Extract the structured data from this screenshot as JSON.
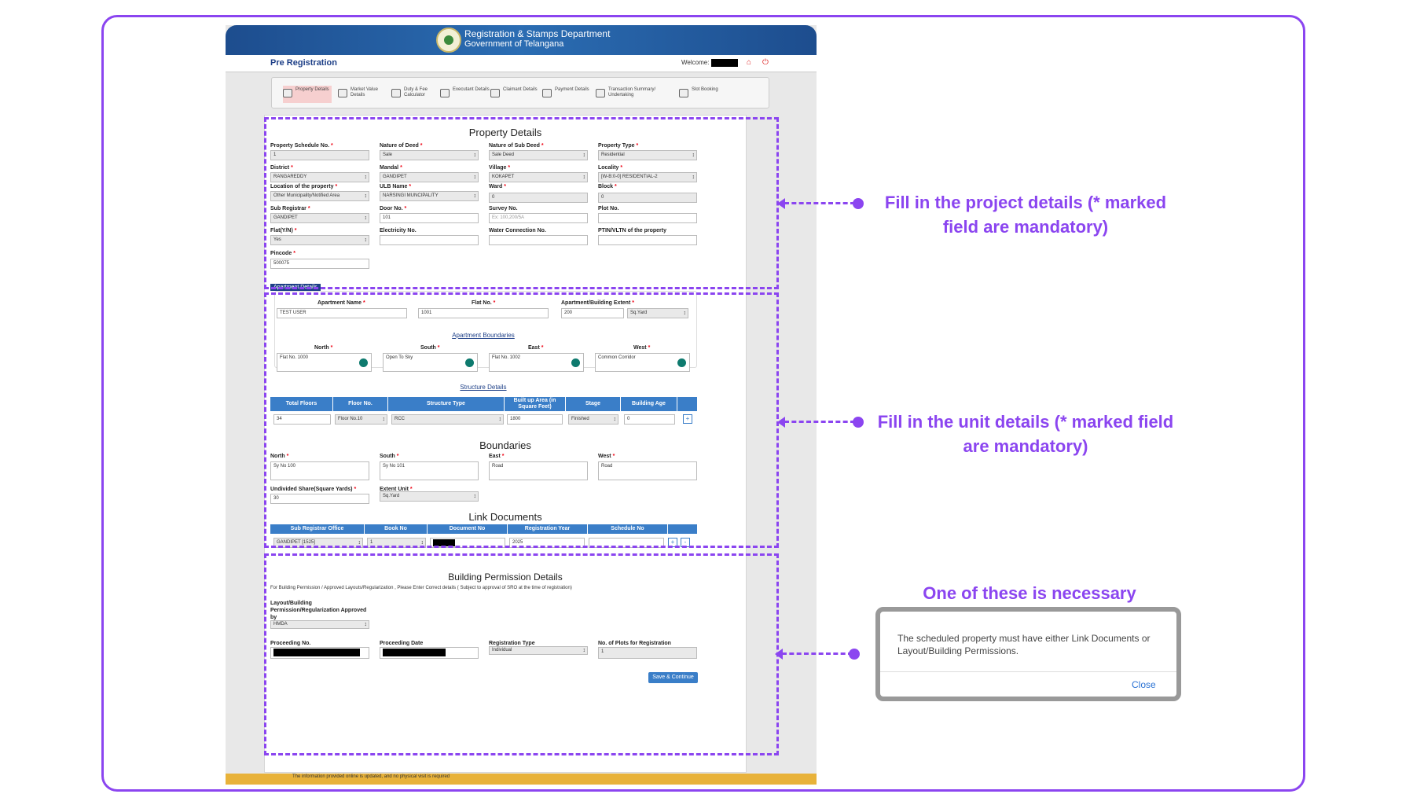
{
  "header": {
    "dept": "Registration & Stamps Department",
    "gov": "Government of Telangana",
    "page_title": "Pre Registration",
    "welcome": "Welcome:"
  },
  "steps": [
    {
      "label": "Property Details"
    },
    {
      "label": "Market Value Details"
    },
    {
      "label": "Duty & Fee Calculator"
    },
    {
      "label": "Executant Details"
    },
    {
      "label": "Claimant Details"
    },
    {
      "label": "Payment Details"
    },
    {
      "label": "Transaction Summary/ Undertaking"
    },
    {
      "label": "Slot Booking"
    }
  ],
  "property": {
    "title": "Property Details",
    "schedule_no": {
      "label": "Property Schedule No.",
      "value": "1"
    },
    "nature_deed": {
      "label": "Nature of Deed",
      "value": "Sale"
    },
    "nature_sub_deed": {
      "label": "Nature of Sub Deed",
      "value": "Sale Deed"
    },
    "property_type": {
      "label": "Property Type",
      "value": "Residential"
    },
    "district": {
      "label": "District",
      "value": "RANGAREDDY"
    },
    "mandal": {
      "label": "Mandal",
      "value": "GANDIPET"
    },
    "village": {
      "label": "Village",
      "value": "KOKAPET"
    },
    "locality": {
      "label": "Locality",
      "value": "[W-B:0-0] RESIDENTIAL-2"
    },
    "location": {
      "label": "Location of the property",
      "value": "Other Municipality/Notified Area"
    },
    "ulb": {
      "label": "ULB Name",
      "value": "NARSINGI MUNCIPALITY"
    },
    "ward": {
      "label": "Ward",
      "value": "0"
    },
    "block": {
      "label": "Block",
      "value": "0"
    },
    "sub_registrar": {
      "label": "Sub Registrar",
      "value": "GANDIPET"
    },
    "door_no": {
      "label": "Door No.",
      "value": "101"
    },
    "survey_no": {
      "label": "Survey No.",
      "placeholder": "Ex: 100,200/5A"
    },
    "plot_no": {
      "label": "Plot No.",
      "value": ""
    },
    "flat": {
      "label": "Flat(Y/N)",
      "value": "Yes"
    },
    "electricity": {
      "label": "Electricity No.",
      "value": ""
    },
    "water": {
      "label": "Water Connection No.",
      "value": ""
    },
    "ptin": {
      "label": "PTIN/VLTN of the property",
      "value": ""
    },
    "pincode": {
      "label": "Pincode",
      "value": "500075"
    }
  },
  "apartment": {
    "tag": "Apartment Details",
    "name": {
      "label": "Apartment Name",
      "value": "TEST USER"
    },
    "flat_no": {
      "label": "Flat No.",
      "value": "1001"
    },
    "extent": {
      "label": "Apartment/Building Extent",
      "value": "200",
      "unit": "Sq.Yard"
    },
    "boundaries_link": "Apartment Boundaries",
    "north": {
      "label": "North",
      "value": "Flat No. 1000"
    },
    "south": {
      "label": "South",
      "value": "Open To Sky"
    },
    "east": {
      "label": "East",
      "value": "Flat No. 1002"
    },
    "west": {
      "label": "West",
      "value": "Common Corridor"
    },
    "structure_link": "Structure Details",
    "structure_headers": [
      "Total Floors",
      "Floor No.",
      "Structure Type",
      "Built up Area (in Square Feet)",
      "Stage",
      "Building Age"
    ],
    "structure_row": {
      "total_floors": "34",
      "floor_no": "Floor No.10",
      "structure_type": "RCC",
      "built_up": "1800",
      "stage": "Finished",
      "age": "0"
    },
    "add": "+"
  },
  "boundaries": {
    "title": "Boundaries",
    "north": {
      "label": "North",
      "value": "Sy No 100"
    },
    "south": {
      "label": "South",
      "value": "Sy No 101"
    },
    "east": {
      "label": "East",
      "value": "Road"
    },
    "west": {
      "label": "West",
      "value": "Road"
    },
    "undivided": {
      "label": "Undivided Share(Square Yards)",
      "value": "30"
    },
    "extent_unit": {
      "label": "Extent Unit",
      "value": "Sq.Yard"
    }
  },
  "link_docs": {
    "title": "Link Documents",
    "headers": [
      "Sub Registrar Office",
      "Book No",
      "Document No",
      "Registration Year",
      "Schedule No"
    ],
    "row": {
      "sro": "GANDIPET [1525]",
      "book": "1",
      "year": "2025",
      "schedule": ""
    },
    "add": "+",
    "remove": "-"
  },
  "building_permission": {
    "title": "Building Permission Details",
    "note": "For Building Permission / Approved Layouts/Regularization , Please Enter Correct details ( Subject to approval of SRO at the time of registration)",
    "approved_by": {
      "label": "Layout/Building Permission/Regularization Approved by",
      "value": "HMDA"
    },
    "proceeding_no": {
      "label": "Proceeding No."
    },
    "proceeding_date": {
      "label": "Proceeding Date"
    },
    "registration_type": {
      "label": "Registration Type",
      "value": "Individual"
    },
    "plots": {
      "label": "No. of Plots for Registration",
      "value": "1"
    }
  },
  "save_button": "Save & Continue",
  "footer": "The information provided online is updated, and no physical visit is required",
  "annotations": {
    "project": "Fill in the project details (* marked field are mandatory)",
    "unit": "Fill in the unit details (* marked field are mandatory)",
    "one_of": "One of these is necessary"
  },
  "modal": {
    "text": "The scheduled property must have either Link Documents or Layout/Building Permissions.",
    "close": "Close"
  },
  "colors": {
    "accent": "#8b45f0",
    "header_blue": "#1d4d8e",
    "table_blue": "#3a7ec8",
    "required": "#e01"
  }
}
